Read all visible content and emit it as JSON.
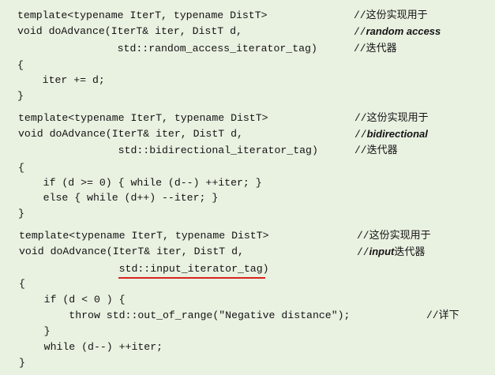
{
  "blocks": [
    {
      "lines": [
        {
          "code": "template<typename IterT, typename DistT>",
          "comment": {
            "prefix": "//",
            "text": "这份实现用于"
          }
        },
        {
          "code": "void doAdvance(IterT& iter, DistT d,",
          "comment": {
            "prefix": "//",
            "em": "random access"
          }
        },
        {
          "code": "                std::random_access_iterator_tag)",
          "comment": {
            "prefix": "//",
            "text": "迭代器"
          }
        },
        {
          "code": "{"
        },
        {
          "code": "    iter += d;"
        },
        {
          "code": "}"
        }
      ]
    },
    {
      "lines": [
        {
          "code": "template<typename IterT, typename DistT>",
          "comment": {
            "prefix": "//",
            "text": "这份实现用于"
          }
        },
        {
          "code": "void doAdvance(IterT& iter, DistT d,",
          "comment": {
            "prefix": "//",
            "em": "bidirectional"
          }
        },
        {
          "code": "                std::bidirectional_iterator_tag)",
          "comment": {
            "prefix": "//",
            "text": "迭代器"
          }
        },
        {
          "code": "{"
        },
        {
          "code": "    if (d >= 0) { while (d--) ++iter; }"
        },
        {
          "code": "    else { while (d++) --iter; }"
        },
        {
          "code": "}"
        }
      ]
    },
    {
      "lines": [
        {
          "code": "template<typename IterT, typename DistT>",
          "comment": {
            "prefix": "//",
            "text": "这份实现用于"
          }
        },
        {
          "code": "void doAdvance(IterT& iter, DistT d,",
          "comment": {
            "prefix": "//",
            "em": "input",
            "text": "迭代器"
          }
        },
        {
          "code": "                std::input_iterator_tag)",
          "highlighted": "std::input_iterator_tag"
        },
        {
          "code": "{"
        },
        {
          "code": "    if (d < 0 ) {"
        },
        {
          "code": "        throw std::out_of_range(\"Negative distance\");",
          "comment": {
            "prefix": "//",
            "text": "详下"
          }
        },
        {
          "code": "    }"
        },
        {
          "code": "    while (d--) ++iter;"
        },
        {
          "code": "}"
        }
      ]
    }
  ],
  "colors": {
    "background": "#e9f1e1",
    "text": "#141414",
    "highlight_underline": "#d8231e"
  }
}
